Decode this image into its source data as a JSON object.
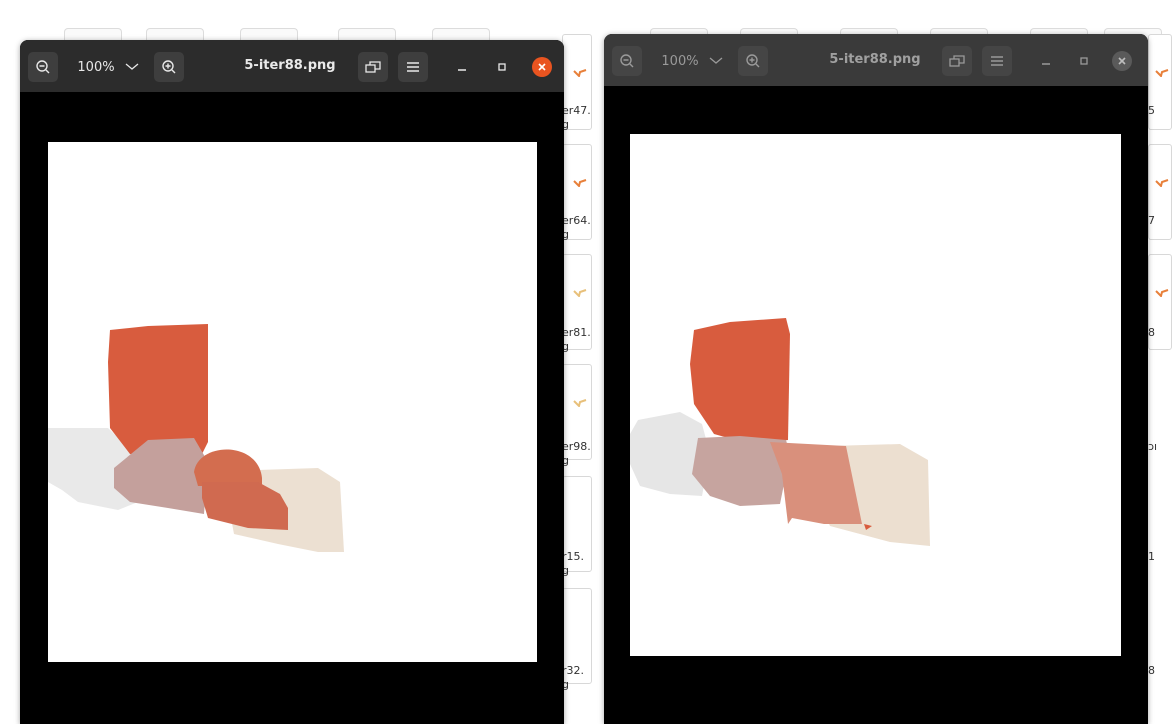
{
  "file_browser": {
    "filenames_partial": [
      "er47.",
      "g",
      "er64.",
      "g",
      "er81.",
      "g",
      "er98.",
      "g",
      "r15.",
      "g",
      "r32.",
      "g"
    ],
    "right_edge_labels": [
      "5",
      "7",
      "8",
      "ɔı",
      "1",
      "8"
    ]
  },
  "viewer_left": {
    "zoom_value": "100%",
    "title": "5-iter88.png",
    "state": "focused"
  },
  "viewer_right": {
    "zoom_value": "100%",
    "title": "5-iter88.png",
    "state": "unfocused"
  },
  "icons": {
    "zoom_out": "zoom-out-icon",
    "zoom_dropdown": "chevron-down-icon",
    "zoom_in": "zoom-in-icon",
    "fullscreen": "fullscreen-icon",
    "menu": "hamburger-menu-icon",
    "minimize": "minimize-icon",
    "maximize": "maximize-icon",
    "close": "close-icon"
  },
  "colors": {
    "accent_close": "#e95420",
    "headerbar": "#2c2c2c",
    "canvas_bg": "#000000",
    "shape_red": "#d85c3e",
    "shape_rose": "#c4a09c",
    "shape_beige": "#ecdfd0",
    "shape_grey": "#e6e6e6",
    "shape_salmon": "#d9907c"
  }
}
